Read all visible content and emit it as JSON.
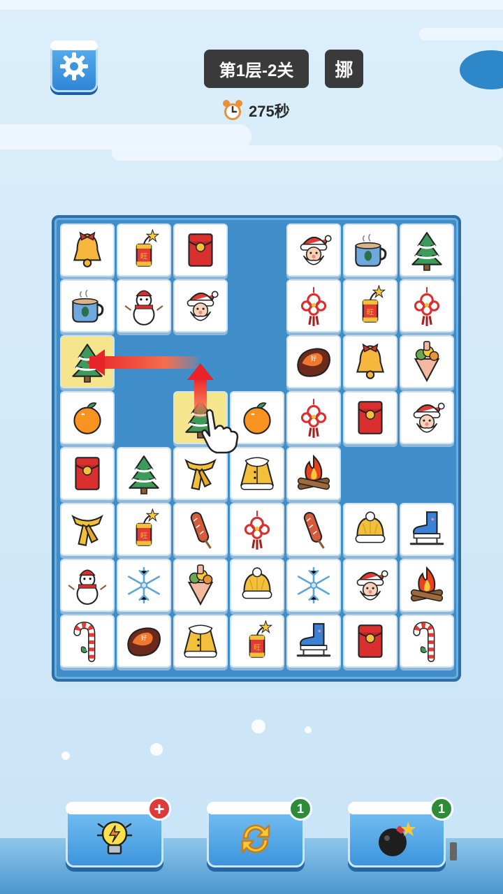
{
  "header": {
    "level_label": "第1层-2关",
    "extra_label": "挪",
    "timer_text": "275秒"
  },
  "board": {
    "rows": 8,
    "cols": 7,
    "tiles": [
      [
        "bell",
        "firecracker",
        "red-envelope",
        null,
        "santa",
        "coffee-cup",
        "tree"
      ],
      [
        "coffee-cup",
        "snowman",
        "santa",
        null,
        "chinese-knot",
        "firecracker",
        "chinese-knot"
      ],
      [
        "tree",
        null,
        null,
        null,
        "sweet-potato",
        "bell",
        "bouquet"
      ],
      [
        "orange",
        null,
        "tree",
        "orange",
        "chinese-knot",
        "red-envelope",
        "santa"
      ],
      [
        "red-envelope",
        "tree",
        "scarf",
        "coat",
        "campfire",
        null,
        null
      ],
      [
        "scarf",
        "firecracker",
        "sausage",
        "chinese-knot",
        "sausage",
        "beanie",
        "skate"
      ],
      [
        "snowman",
        "snowflake",
        "bouquet",
        "beanie",
        "snowflake",
        "santa",
        "campfire"
      ],
      [
        "candy-cane",
        "sweet-potato",
        "coat",
        "firecracker",
        "skate",
        "red-envelope",
        "candy-cane"
      ]
    ],
    "highlighted": [
      [
        2,
        0
      ],
      [
        3,
        2
      ]
    ]
  },
  "tools": [
    {
      "name": "hint",
      "icon": "lightbulb-icon",
      "badge": "+"
    },
    {
      "name": "shuffle",
      "icon": "shuffle-icon",
      "badge": "1"
    },
    {
      "name": "bomb",
      "icon": "bomb-icon",
      "badge": "1"
    }
  ],
  "colors": {
    "board": "#3f8ec9",
    "highlight": "#f5e68d",
    "arrow": "#e8232a",
    "pill": "#3a3a3a"
  }
}
